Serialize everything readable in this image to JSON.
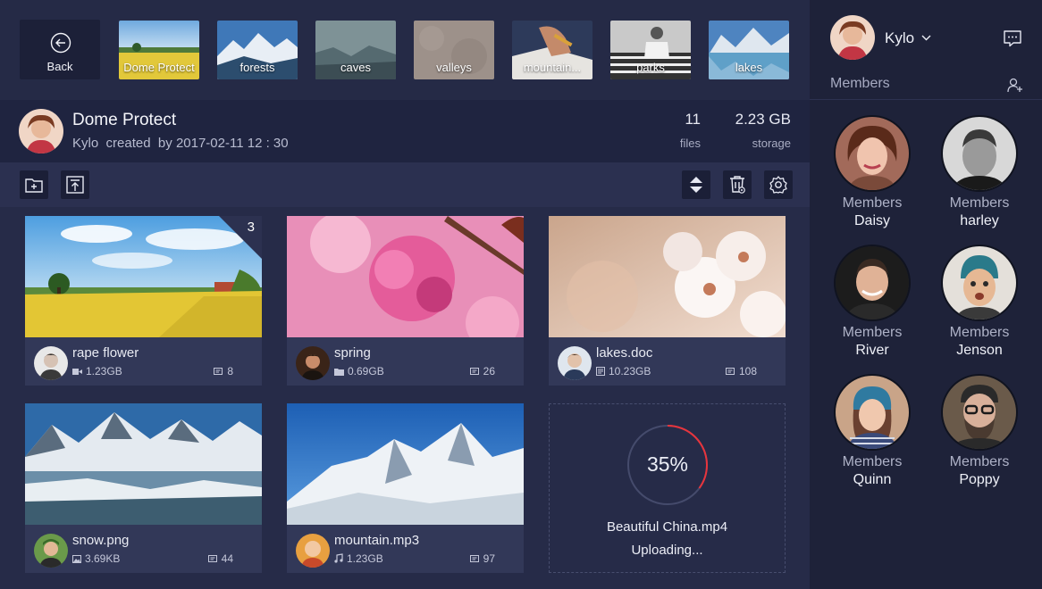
{
  "topbar": {
    "back_label": "Back",
    "albums": [
      {
        "label": "Dome Protect"
      },
      {
        "label": "forests"
      },
      {
        "label": "caves"
      },
      {
        "label": "valleys"
      },
      {
        "label": "mountain..."
      },
      {
        "label": "parks"
      },
      {
        "label": "lakes"
      }
    ]
  },
  "folder": {
    "title": "Dome Protect",
    "owner": "Kylo",
    "created_label": "created",
    "by_label": "by",
    "created_at": "2017-02-11 12 : 30",
    "files_count": "11",
    "files_label": "files",
    "storage_value": "2.23 GB",
    "storage_label": "storage"
  },
  "files": [
    {
      "name": "rape flower",
      "size": "1.23GB",
      "type_icon": "video-icon",
      "count": "8",
      "badge": "3"
    },
    {
      "name": "spring",
      "size": "0.69GB",
      "type_icon": "folder-icon",
      "count": "26"
    },
    {
      "name": "lakes.doc",
      "size": "10.23GB",
      "type_icon": "document-icon",
      "count": "108"
    },
    {
      "name": "snow.png",
      "size": "3.69KB",
      "type_icon": "image-icon",
      "count": "44"
    },
    {
      "name": "mountain.mp3",
      "size": "1.23GB",
      "type_icon": "music-icon",
      "count": "97"
    }
  ],
  "upload": {
    "progress_text": "35%",
    "progress_fraction": 0.35,
    "file_name": "Beautiful China.mp4",
    "status": "Uploading..."
  },
  "user": {
    "name": "Kylo"
  },
  "members": {
    "label": "Members",
    "list": [
      {
        "role": "Members",
        "name": "Daisy"
      },
      {
        "role": "Members",
        "name": "harley"
      },
      {
        "role": "Members",
        "name": "River"
      },
      {
        "role": "Members",
        "name": "Jenson"
      },
      {
        "role": "Members",
        "name": "Quinn"
      },
      {
        "role": "Members",
        "name": "Poppy"
      }
    ]
  },
  "colors": {
    "accent_red": "#e8343c",
    "ring_track": "#454b6c",
    "background": "#262b48",
    "sidebar": "#1e2239"
  }
}
